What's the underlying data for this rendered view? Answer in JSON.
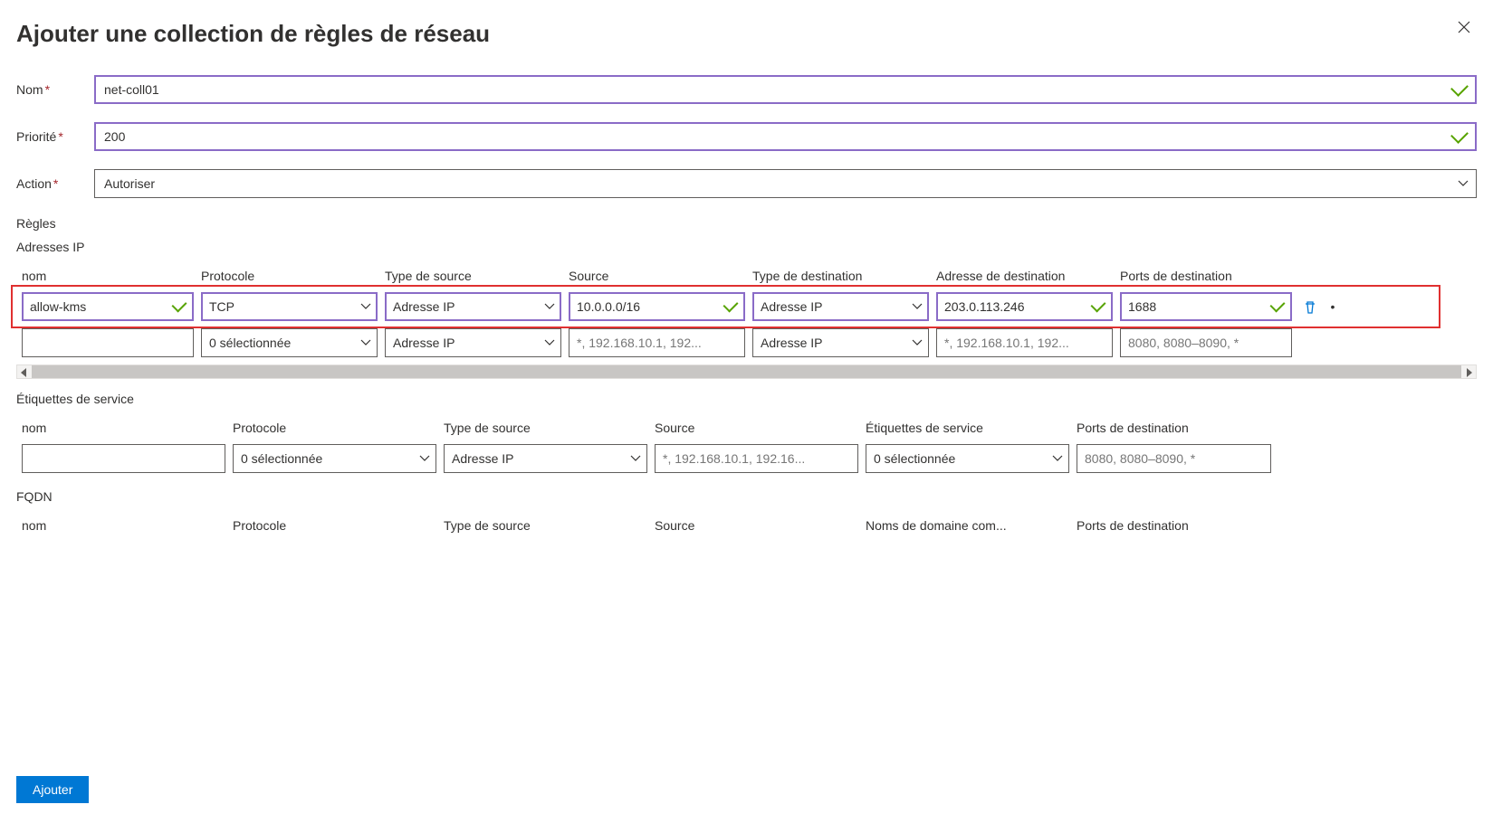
{
  "title": "Ajouter une collection de règles de réseau",
  "fields": {
    "name": {
      "label": "Nom",
      "value": "net-coll01"
    },
    "prio": {
      "label": "Priorité",
      "value": "200"
    },
    "action": {
      "label": "Action",
      "value": "Autoriser"
    }
  },
  "rules_heading": "Règles",
  "ip_section": {
    "title": "Adresses IP",
    "headers": [
      "nom",
      "Protocole",
      "Type de source",
      "Source",
      "Type de destination",
      "Adresse de destination",
      "Ports de destination"
    ],
    "rows": [
      {
        "name": "allow-kms",
        "proto": "TCP",
        "stype": "Adresse IP",
        "source": "10.0.0.0/16",
        "dtype": "Adresse IP",
        "daddr": "203.0.113.246",
        "dport": "1688",
        "valid": true
      },
      {
        "name": "",
        "proto": "0 sélectionnée",
        "stype": "Adresse IP",
        "source_ph": "*, 192.168.10.1, 192...",
        "dtype": "Adresse IP",
        "daddr_ph": "*, 192.168.10.1, 192...",
        "dport_ph": "8080, 8080–8090, *"
      }
    ]
  },
  "svc_section": {
    "title": "Étiquettes de service",
    "headers": [
      "nom",
      "Protocole",
      "Type de source",
      "Source",
      "Étiquettes de service",
      "Ports de destination"
    ],
    "row": {
      "proto": "0 sélectionnée",
      "stype": "Adresse IP",
      "source_ph": "*, 192.168.10.1, 192.16...",
      "svc": "0 sélectionnée",
      "dport_ph": "8080, 8080–8090, *"
    }
  },
  "fqdn_section": {
    "title": "FQDN",
    "headers": [
      "nom",
      "Protocole",
      "Type de source",
      "Source",
      "Noms de domaine com...",
      "Ports de destination"
    ]
  },
  "add_button": "Ajouter"
}
